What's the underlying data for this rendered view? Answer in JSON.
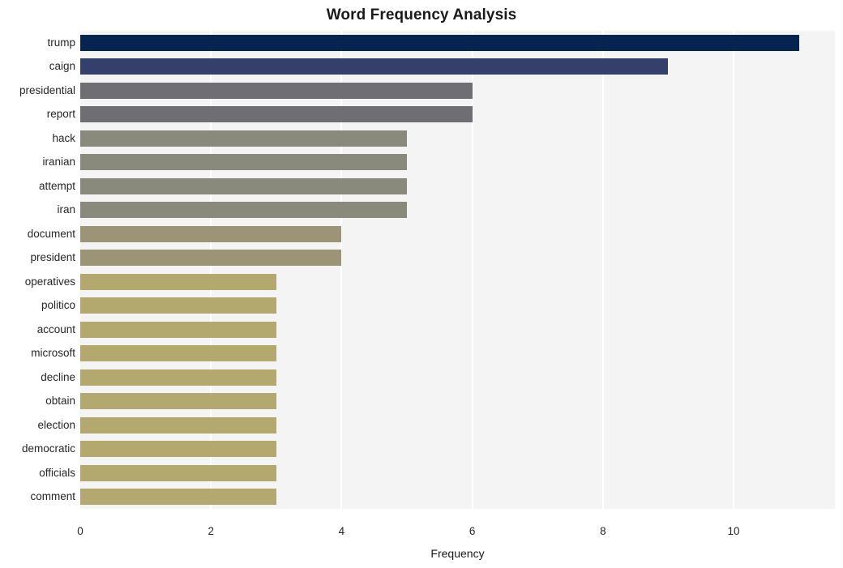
{
  "chart_data": {
    "type": "bar",
    "orientation": "horizontal",
    "title": "Word Frequency Analysis",
    "xlabel": "Frequency",
    "ylabel": "",
    "xlim": [
      0,
      11.55
    ],
    "xticks": [
      0,
      2,
      4,
      6,
      8,
      10
    ],
    "xtick_labels": [
      "0",
      "2",
      "4",
      "6",
      "8",
      "10"
    ],
    "grid": "vertical-white-on-light-gray",
    "legend": "none",
    "categories": [
      "trump",
      "caign",
      "presidential",
      "report",
      "hack",
      "iranian",
      "attempt",
      "iran",
      "document",
      "president",
      "operatives",
      "politico",
      "account",
      "microsoft",
      "decline",
      "obtain",
      "election",
      "democratic",
      "officials",
      "comment"
    ],
    "values": [
      11,
      9,
      6,
      6,
      5,
      5,
      5,
      5,
      4,
      4,
      3,
      3,
      3,
      3,
      3,
      3,
      3,
      3,
      3,
      3
    ],
    "bar_colors": [
      "#062450",
      "#33406b",
      "#6e6e73",
      "#6e6e73",
      "#8a8a7c",
      "#8a8a7c",
      "#8a8a7c",
      "#8a8a7c",
      "#9b9476",
      "#9b9476",
      "#b3a86e",
      "#b3a86e",
      "#b3a86e",
      "#b3a86e",
      "#b3a86e",
      "#b3a86e",
      "#b3a86e",
      "#b3a86e",
      "#b3a86e",
      "#b3a86e"
    ]
  },
  "colors": {
    "plot_background": "#f4f4f4",
    "page_background": "#ffffff",
    "gridline": "#ffffff",
    "text": "#262626",
    "title_text": "#1a1a1a"
  }
}
